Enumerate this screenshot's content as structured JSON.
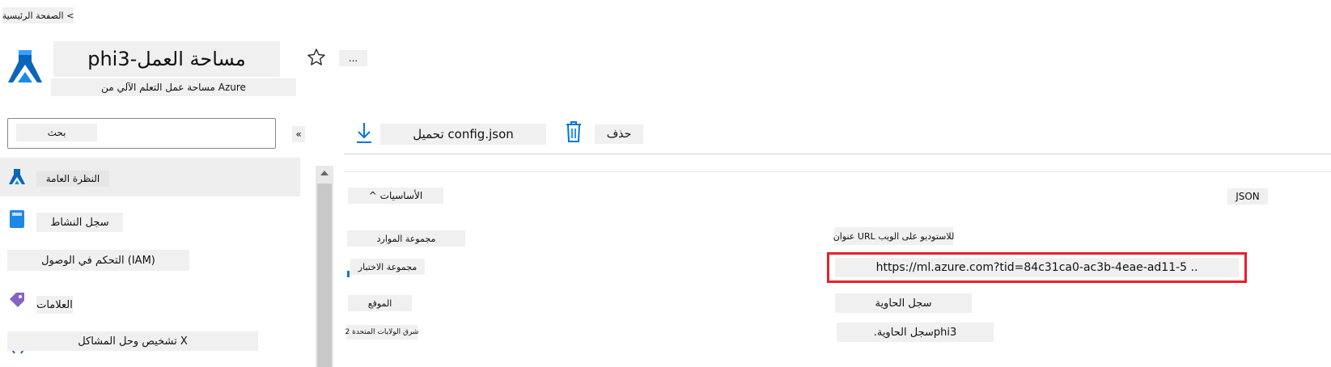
{
  "breadcrumb": {
    "label": "الصفحة الرئيسية <"
  },
  "header": {
    "title": "phi3-مساحة العمل",
    "subtitle": "مساحة عمل التعلم الآلي من Azure",
    "more_label": "..."
  },
  "search": {
    "placeholder": "بحث"
  },
  "collapse_label": "«",
  "sidebar": {
    "items": [
      {
        "label": "النظرة العامة",
        "icon": "flask-icon"
      },
      {
        "label": "سجل النشاط",
        "icon": "book-icon"
      },
      {
        "label": "التحكم في الوصول (IAM)",
        "icon": ""
      },
      {
        "label": "العلامات",
        "icon": "tag-icon"
      },
      {
        "label": "تشخيص وحل المشاكل X",
        "icon": "wrench-icon"
      }
    ]
  },
  "toolbar": {
    "download_label": "تحميل config.json",
    "delete_label": "حذف"
  },
  "essentials": {
    "toggle_label": "^ الأساسيات",
    "json_label": "JSON",
    "left": [
      {
        "label": "مجموعة الموارد",
        "value": ""
      },
      {
        "label": "مجموعة الاختبار",
        "value": ""
      },
      {
        "label": "الموقع",
        "value": "شرق الولايات المتحدة 2"
      }
    ],
    "right": [
      {
        "label": "عنوان URL للاستوديو على الويب",
        "value": "https://ml.azure.com?tid=84c31ca0-ac3b-4eae-ad11-5 .."
      },
      {
        "label": "سجل الحاوية",
        "value": ".سجل الحاويةphi3"
      }
    ]
  },
  "colors": {
    "accent": "#0078d4",
    "highlight_border": "#e8202b",
    "tag_purple": "#8661c5"
  }
}
